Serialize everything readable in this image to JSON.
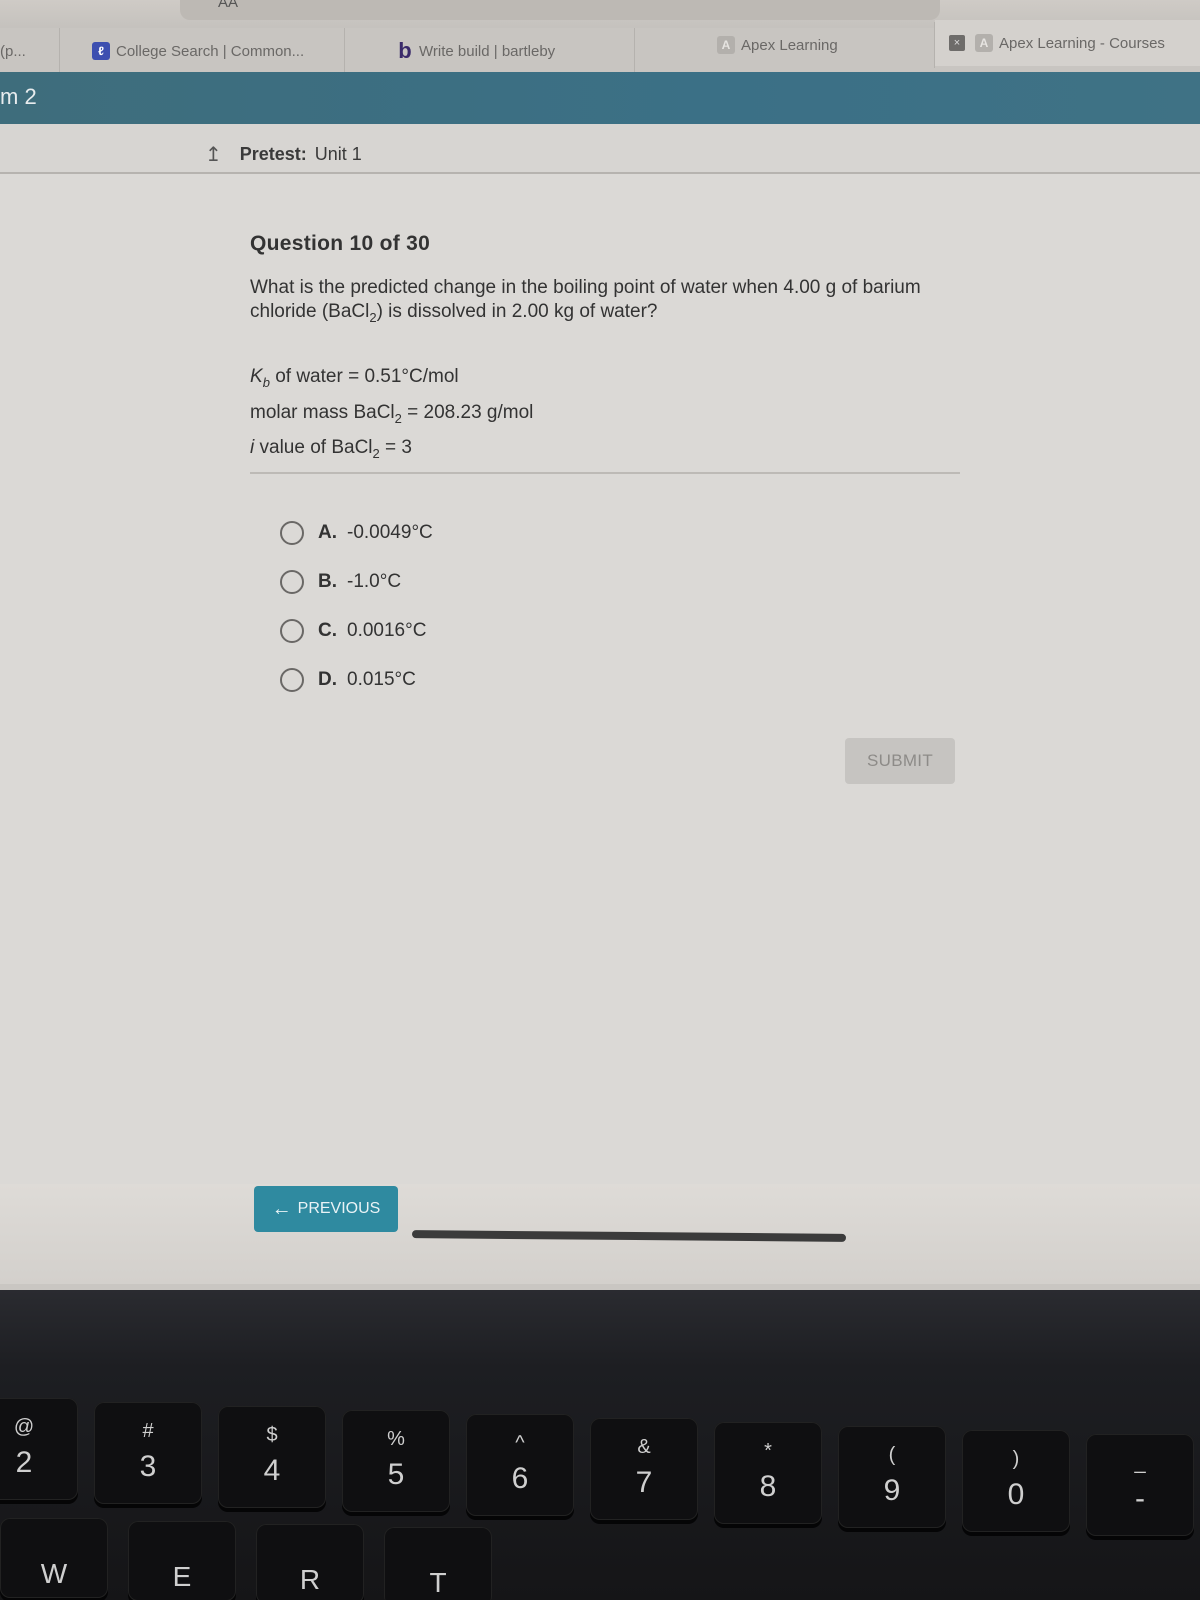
{
  "browser": {
    "reader_button": "AA",
    "tabs": [
      {
        "label": "(p...",
        "favicon": "generic"
      },
      {
        "label": "College Search | Common...",
        "favicon": "common-app-icon"
      },
      {
        "label": "Write build | bartleby",
        "favicon": "b"
      },
      {
        "label": "Apex Learning",
        "favicon": "A"
      },
      {
        "label": "Apex Learning - Courses",
        "favicon": "A",
        "close": "×"
      }
    ]
  },
  "app_header": {
    "title": "m 2"
  },
  "breadcrumb": {
    "icon": "up-arrow-icon",
    "label": "Pretest:",
    "value": "Unit 1"
  },
  "question": {
    "number_text": "Question 10 of 30",
    "prompt_part1": "What is the predicted change in the boiling point of water when 4.00 g of barium chloride (BaCl",
    "prompt_sub": "2",
    "prompt_part2": ") is dissolved in 2.00 kg of water?",
    "givens": [
      {
        "prefix": "K",
        "prefix_sub": "b",
        "text": " of water = 0.51°C/mol"
      },
      {
        "text": "molar mass BaCl",
        "sub": "2",
        "suffix": " = 208.23 g/mol"
      },
      {
        "italic": "i",
        "text": " value of BaCl",
        "sub": "2",
        "suffix": " = 3"
      }
    ]
  },
  "choices": [
    {
      "letter": "A.",
      "value": "-0.0049°C",
      "selected": false
    },
    {
      "letter": "B.",
      "value": "-1.0°C",
      "selected": false
    },
    {
      "letter": "C.",
      "value": "0.0016°C",
      "selected": false
    },
    {
      "letter": "D.",
      "value": "0.015°C",
      "selected": false
    }
  ],
  "buttons": {
    "submit": "SUBMIT",
    "previous": "PREVIOUS",
    "previous_icon": "←"
  },
  "progress": {
    "current": 10,
    "total": 30
  },
  "keyboard": {
    "number_row": [
      {
        "sym": "@",
        "num": "2"
      },
      {
        "sym": "#",
        "num": "3"
      },
      {
        "sym": "$",
        "num": "4"
      },
      {
        "sym": "%",
        "num": "5"
      },
      {
        "sym": "^",
        "num": "6"
      },
      {
        "sym": "&",
        "num": "7"
      },
      {
        "sym": "*",
        "num": "8"
      },
      {
        "sym": "(",
        "num": "9"
      },
      {
        "sym": ")",
        "num": "0"
      },
      {
        "sym": "_",
        "num": "-"
      }
    ],
    "letter_row": [
      "W",
      "E",
      "R",
      "T"
    ]
  },
  "colors": {
    "teal_header": "#3b7086",
    "previous_button": "#2f8aa0",
    "submit_disabled": "#c6c4c1"
  }
}
